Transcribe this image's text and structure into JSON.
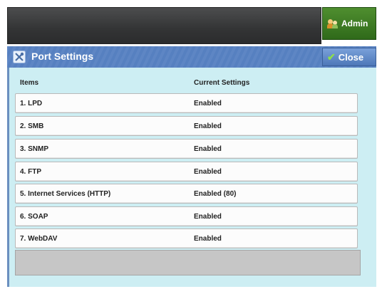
{
  "topbar": {
    "admin_label": "Admin"
  },
  "header": {
    "title": "Port Settings",
    "close_label": "Close"
  },
  "columns": {
    "items": "Items",
    "current": "Current Settings"
  },
  "rows": [
    {
      "item": "1. LPD",
      "value": "Enabled"
    },
    {
      "item": "2. SMB",
      "value": "Enabled"
    },
    {
      "item": "3. SNMP",
      "value": "Enabled"
    },
    {
      "item": "4. FTP",
      "value": "Enabled"
    },
    {
      "item": "5. Internet Services (HTTP)",
      "value": "Enabled (80)"
    },
    {
      "item": "6. SOAP",
      "value": "Enabled"
    },
    {
      "item": "7. WebDAV",
      "value": "Enabled"
    }
  ],
  "colors": {
    "header": "#5e86c4",
    "panel": "#cdeef3",
    "admin": "#3c7a22"
  },
  "icons": {
    "header": "tools-icon",
    "admin": "admin-users-icon",
    "close": "checkmark-icon"
  }
}
